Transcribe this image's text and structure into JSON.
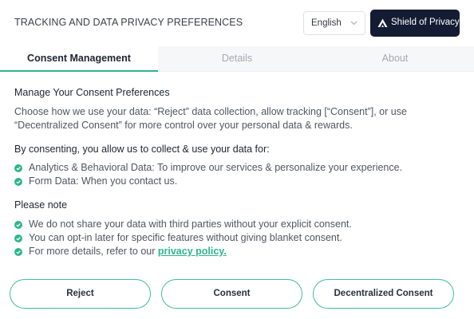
{
  "header": {
    "title": "TRACKING AND DATA PRIVACY PREFERENCES",
    "language": {
      "selected": "English"
    },
    "brand_button": {
      "label": "Shield of Privacy",
      "icon": "shield-logo-icon"
    }
  },
  "tabs": [
    {
      "label": "Consent Management",
      "active": true
    },
    {
      "label": "Details",
      "active": false
    },
    {
      "label": "About",
      "active": false
    }
  ],
  "main": {
    "section_title": "Manage Your Consent Preferences",
    "intro": "Choose how we use your data: “Reject” data collection, allow tracking [“Consent”], or use “Decentralized Consent” for more control over your personal data & rewards.",
    "lead": "By consenting, you allow us to collect & use your data for:",
    "uses": [
      "Analytics & Behavioral Data: To improve our services & personalize your experience.",
      "Form Data: When you contact us."
    ],
    "note_title": "Please note",
    "notes": [
      "We do not share your data with third parties without your explicit consent.",
      "You can opt-in later for specific features without giving blanket consent."
    ],
    "policy_note_prefix": "For more details, refer to our ",
    "policy_link": "privacy policy."
  },
  "actions": {
    "reject": "Reject",
    "consent": "Consent",
    "decentralized": "Decentralized Consent"
  },
  "colors": {
    "accent": "#2fb58e",
    "brand_dark": "#131c33"
  },
  "icons": {
    "bullet": "check-circle-icon",
    "dropdown": "chevron-down-icon"
  }
}
